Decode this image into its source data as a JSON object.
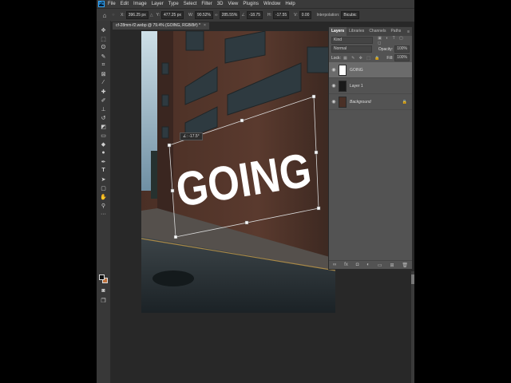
{
  "menubar": {
    "logo": "Ps",
    "items": [
      "File",
      "Edit",
      "Image",
      "Layer",
      "Type",
      "Select",
      "Filter",
      "3D",
      "View",
      "Plugins",
      "Window",
      "Help"
    ]
  },
  "options": {
    "x_label": "X:",
    "x_value": "396.25 px",
    "y_label": "Y:",
    "y_value": "477.25 px",
    "w_label": "W:",
    "w_value": "90.52%",
    "h_label": "H:",
    "h_value": "285.55%",
    "angle_value": "-18.75",
    "hskew_label": "H:",
    "hskew_value": "-17.55",
    "vskew_label": "V:",
    "vskew_value": "0.00",
    "interp_label": "Interpolation:",
    "interp_value": "Bicubic"
  },
  "document": {
    "tab_title": "cf-28mm-f2.webp @ 79.4% (GOING, RGB/8#) *",
    "close": "×",
    "canvas_text": "GOING",
    "angle_readout": "∠: -17.5°"
  },
  "layers_panel": {
    "tabs": [
      "Layers",
      "Libraries",
      "Channels",
      "Paths"
    ],
    "search_placeholder": "Kind",
    "blend_mode": "Normal",
    "opacity_label": "Opacity:",
    "opacity_value": "100%",
    "lock_label": "Lock:",
    "fill_label": "Fill:",
    "fill_value": "100%",
    "layers": [
      {
        "name": "GOING",
        "selected": true
      },
      {
        "name": "Layer 1",
        "selected": false
      },
      {
        "name": "Background",
        "selected": false
      }
    ]
  },
  "colors": {
    "foreground": "#111111",
    "background": "#c0703a"
  }
}
